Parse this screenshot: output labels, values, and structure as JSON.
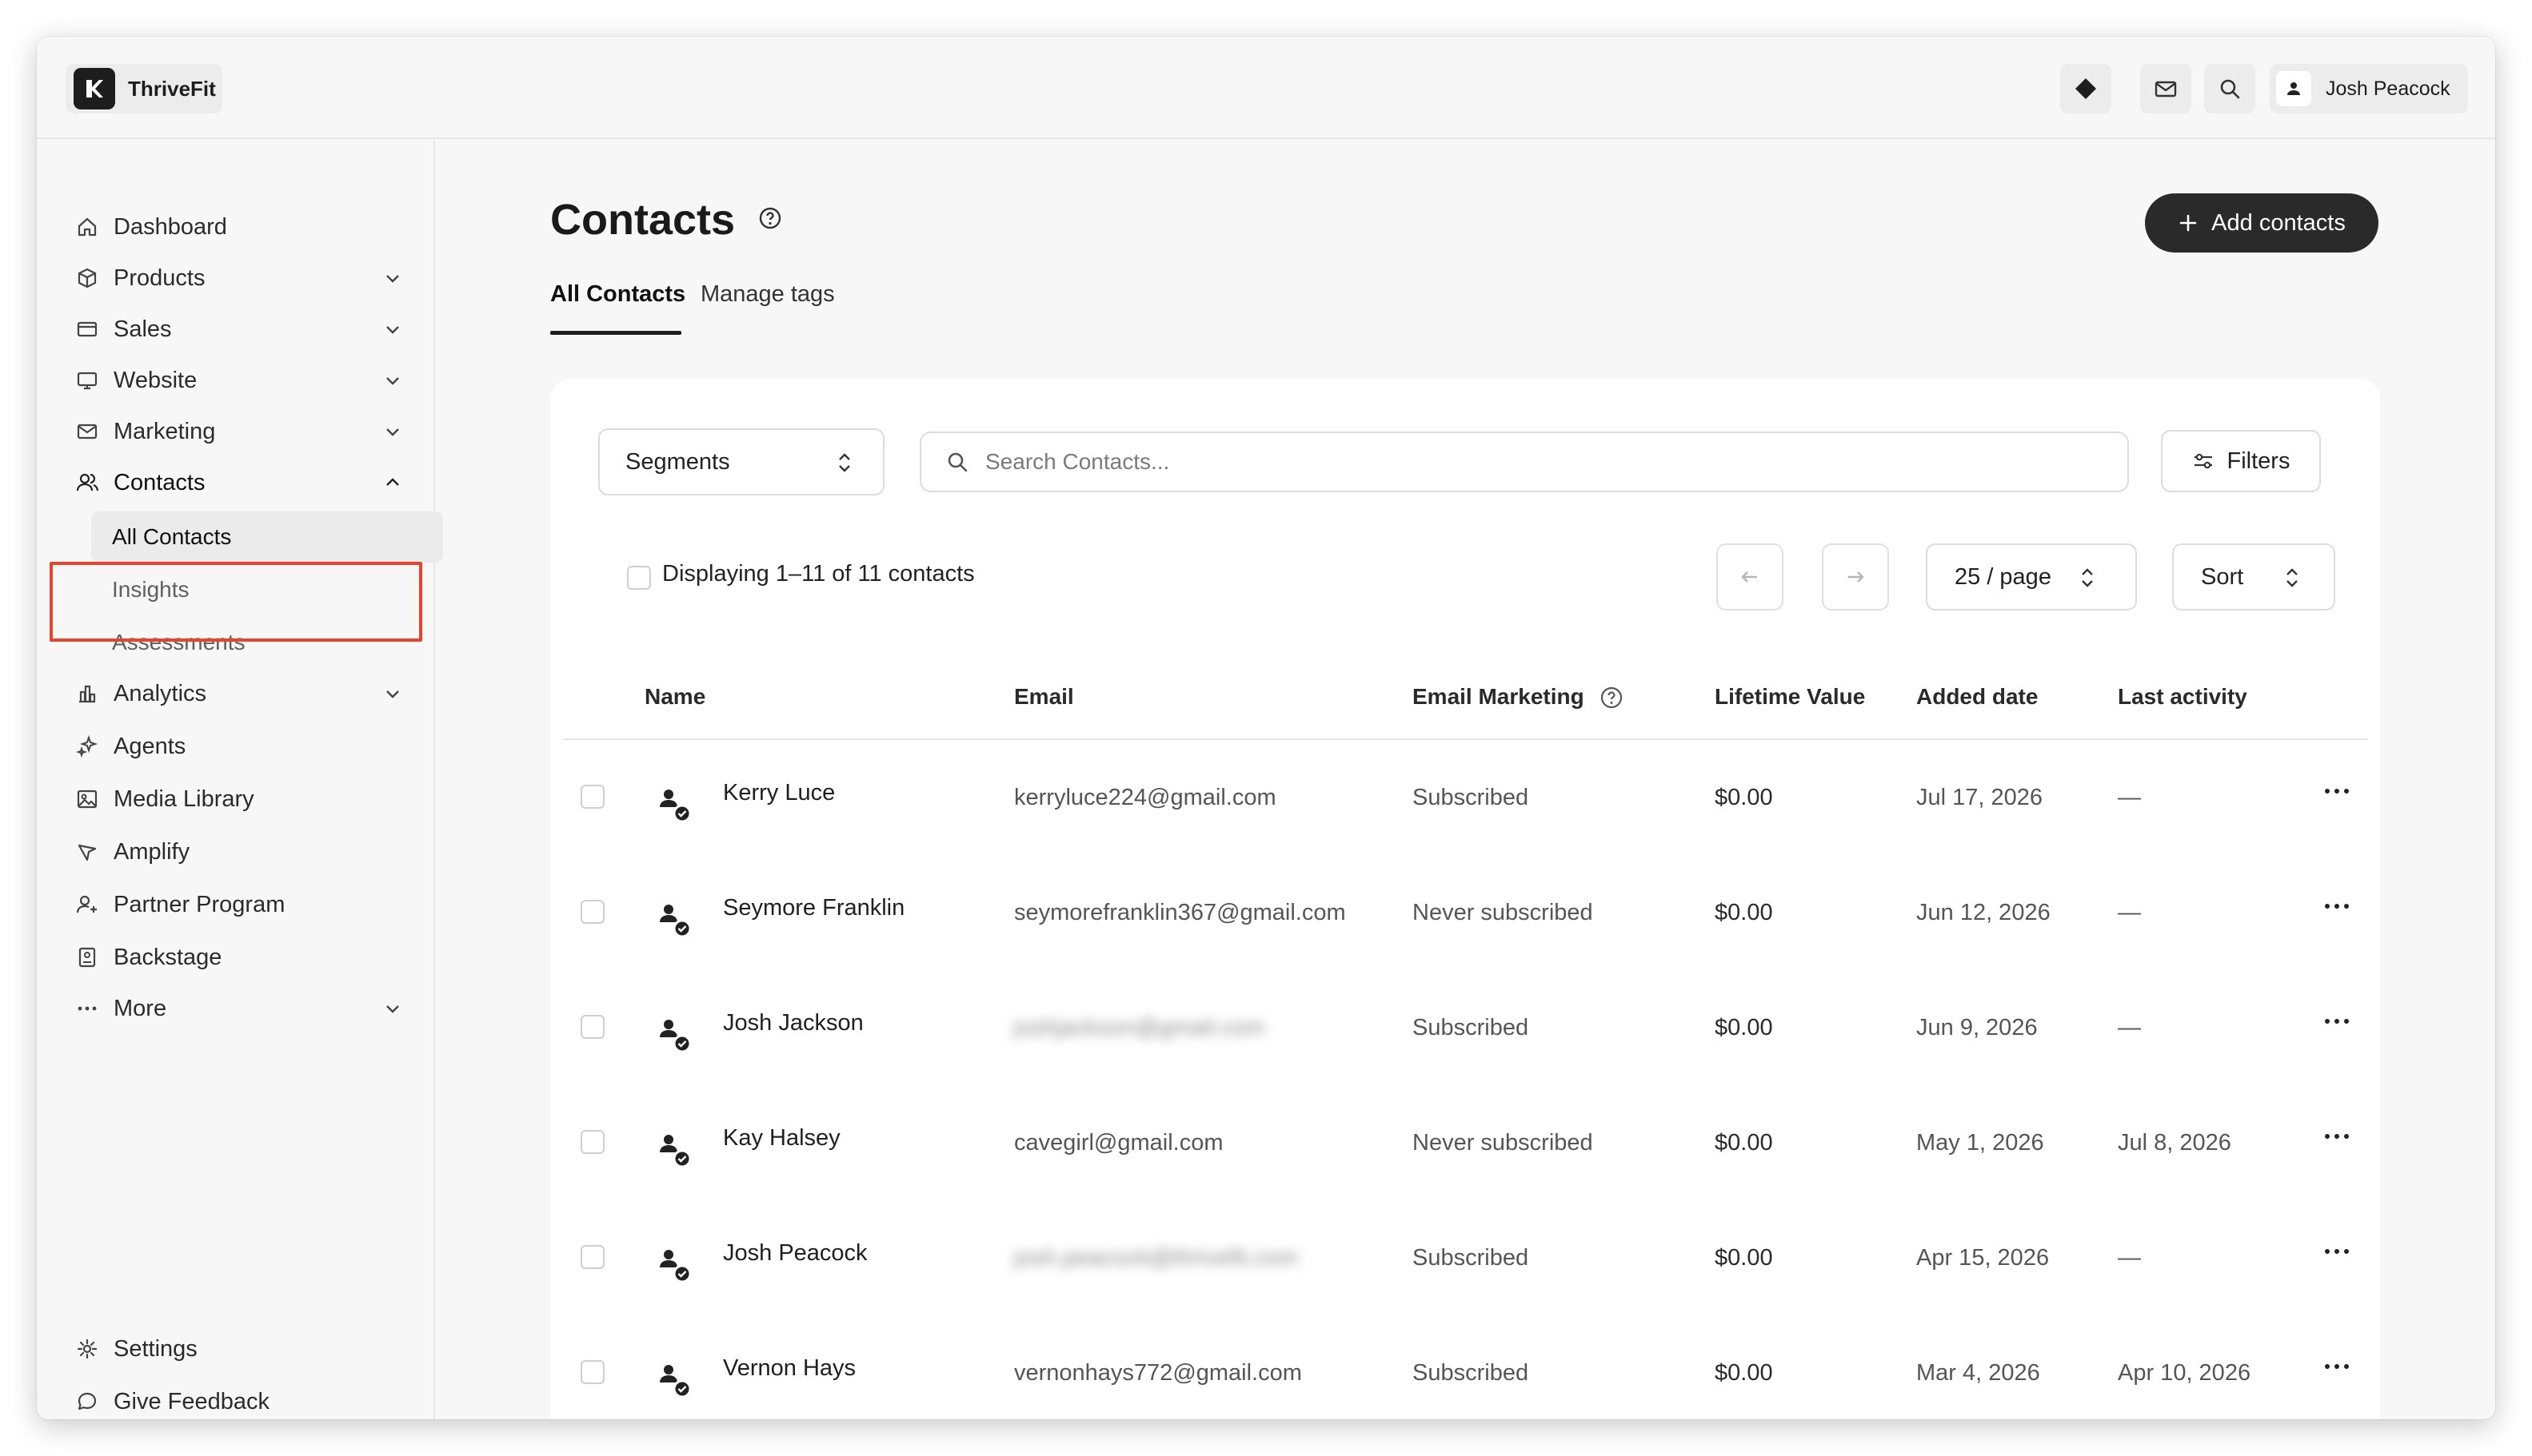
{
  "app": {
    "brand_name": "ThriveFit",
    "user_name": "Josh Peacock"
  },
  "topbar": {
    "icons": [
      "diamond-icon",
      "mail-icon",
      "search-icon"
    ]
  },
  "sidebar": {
    "items": [
      {
        "label": "Dashboard",
        "icon": "home-icon",
        "expandable": false
      },
      {
        "label": "Products",
        "icon": "box-icon",
        "expandable": true
      },
      {
        "label": "Sales",
        "icon": "card-icon",
        "expandable": true
      },
      {
        "label": "Website",
        "icon": "monitor-icon",
        "expandable": true
      },
      {
        "label": "Marketing",
        "icon": "mail-icon",
        "expandable": true
      },
      {
        "label": "Contacts",
        "icon": "users-icon",
        "expandable": true,
        "expanded": true
      },
      {
        "label": "Analytics",
        "icon": "chart-icon",
        "expandable": true
      },
      {
        "label": "Agents",
        "icon": "sparkle-icon",
        "expandable": false
      },
      {
        "label": "Media Library",
        "icon": "image-icon",
        "expandable": false
      },
      {
        "label": "Amplify",
        "icon": "megaphone-icon",
        "expandable": false
      },
      {
        "label": "Partner Program",
        "icon": "partner-icon",
        "expandable": false
      },
      {
        "label": "Backstage",
        "icon": "backstage-icon",
        "expandable": false
      },
      {
        "label": "More",
        "icon": "more-icon",
        "expandable": true
      }
    ],
    "contacts_sub": [
      {
        "label": "All Contacts",
        "active": true
      },
      {
        "label": "Insights",
        "active": false
      },
      {
        "label": "Assessments",
        "active": false
      }
    ],
    "footer": [
      {
        "label": "Settings",
        "icon": "gear-icon"
      },
      {
        "label": "Give Feedback",
        "icon": "chat-icon"
      }
    ]
  },
  "main": {
    "title": "Contacts",
    "add_button": "Add contacts",
    "tabs": [
      {
        "label": "All Contacts",
        "active": true
      },
      {
        "label": "Manage tags",
        "active": false
      }
    ],
    "segments_label": "Segments",
    "search_placeholder": "Search Contacts...",
    "filters_label": "Filters",
    "status_text": "Displaying 1–11 of 11 contacts",
    "per_page": "25 / page",
    "sort_label": "Sort",
    "columns": [
      "Name",
      "Email",
      "Email Marketing",
      "Lifetime Value",
      "Added date",
      "Last activity"
    ],
    "rows": [
      {
        "name": "Kerry Luce",
        "email": "kerryluce224@gmail.com",
        "email_redacted": false,
        "marketing": "Subscribed",
        "value": "$0.00",
        "added": "Jul 17, 2026",
        "last": "—"
      },
      {
        "name": "Seymore Franklin",
        "email": "seymorefranklin367@gmail.com",
        "email_redacted": false,
        "marketing": "Never subscribed",
        "value": "$0.00",
        "added": "Jun 12, 2026",
        "last": "—"
      },
      {
        "name": "Josh Jackson",
        "email": "joshjackson@gmail.com",
        "email_redacted": true,
        "marketing": "Subscribed",
        "value": "$0.00",
        "added": "Jun 9, 2026",
        "last": "—"
      },
      {
        "name": "Kay Halsey",
        "email": "cavegirl@gmail.com",
        "email_redacted": false,
        "marketing": "Never subscribed",
        "value": "$0.00",
        "added": "May 1, 2026",
        "last": "Jul 8, 2026"
      },
      {
        "name": "Josh Peacock",
        "email": "josh.peacock@thrivefit.com",
        "email_redacted": true,
        "marketing": "Subscribed",
        "value": "$0.00",
        "added": "Apr 15, 2026",
        "last": "—"
      },
      {
        "name": "Vernon Hays",
        "email": "vernonhays772@gmail.com",
        "email_redacted": false,
        "marketing": "Subscribed",
        "value": "$0.00",
        "added": "Mar 4, 2026",
        "last": "Apr 10, 2026"
      }
    ]
  },
  "colors": {
    "accent_dark": "#2a2a2a",
    "highlight": "#e8432c",
    "background": "#f7f7f7"
  }
}
